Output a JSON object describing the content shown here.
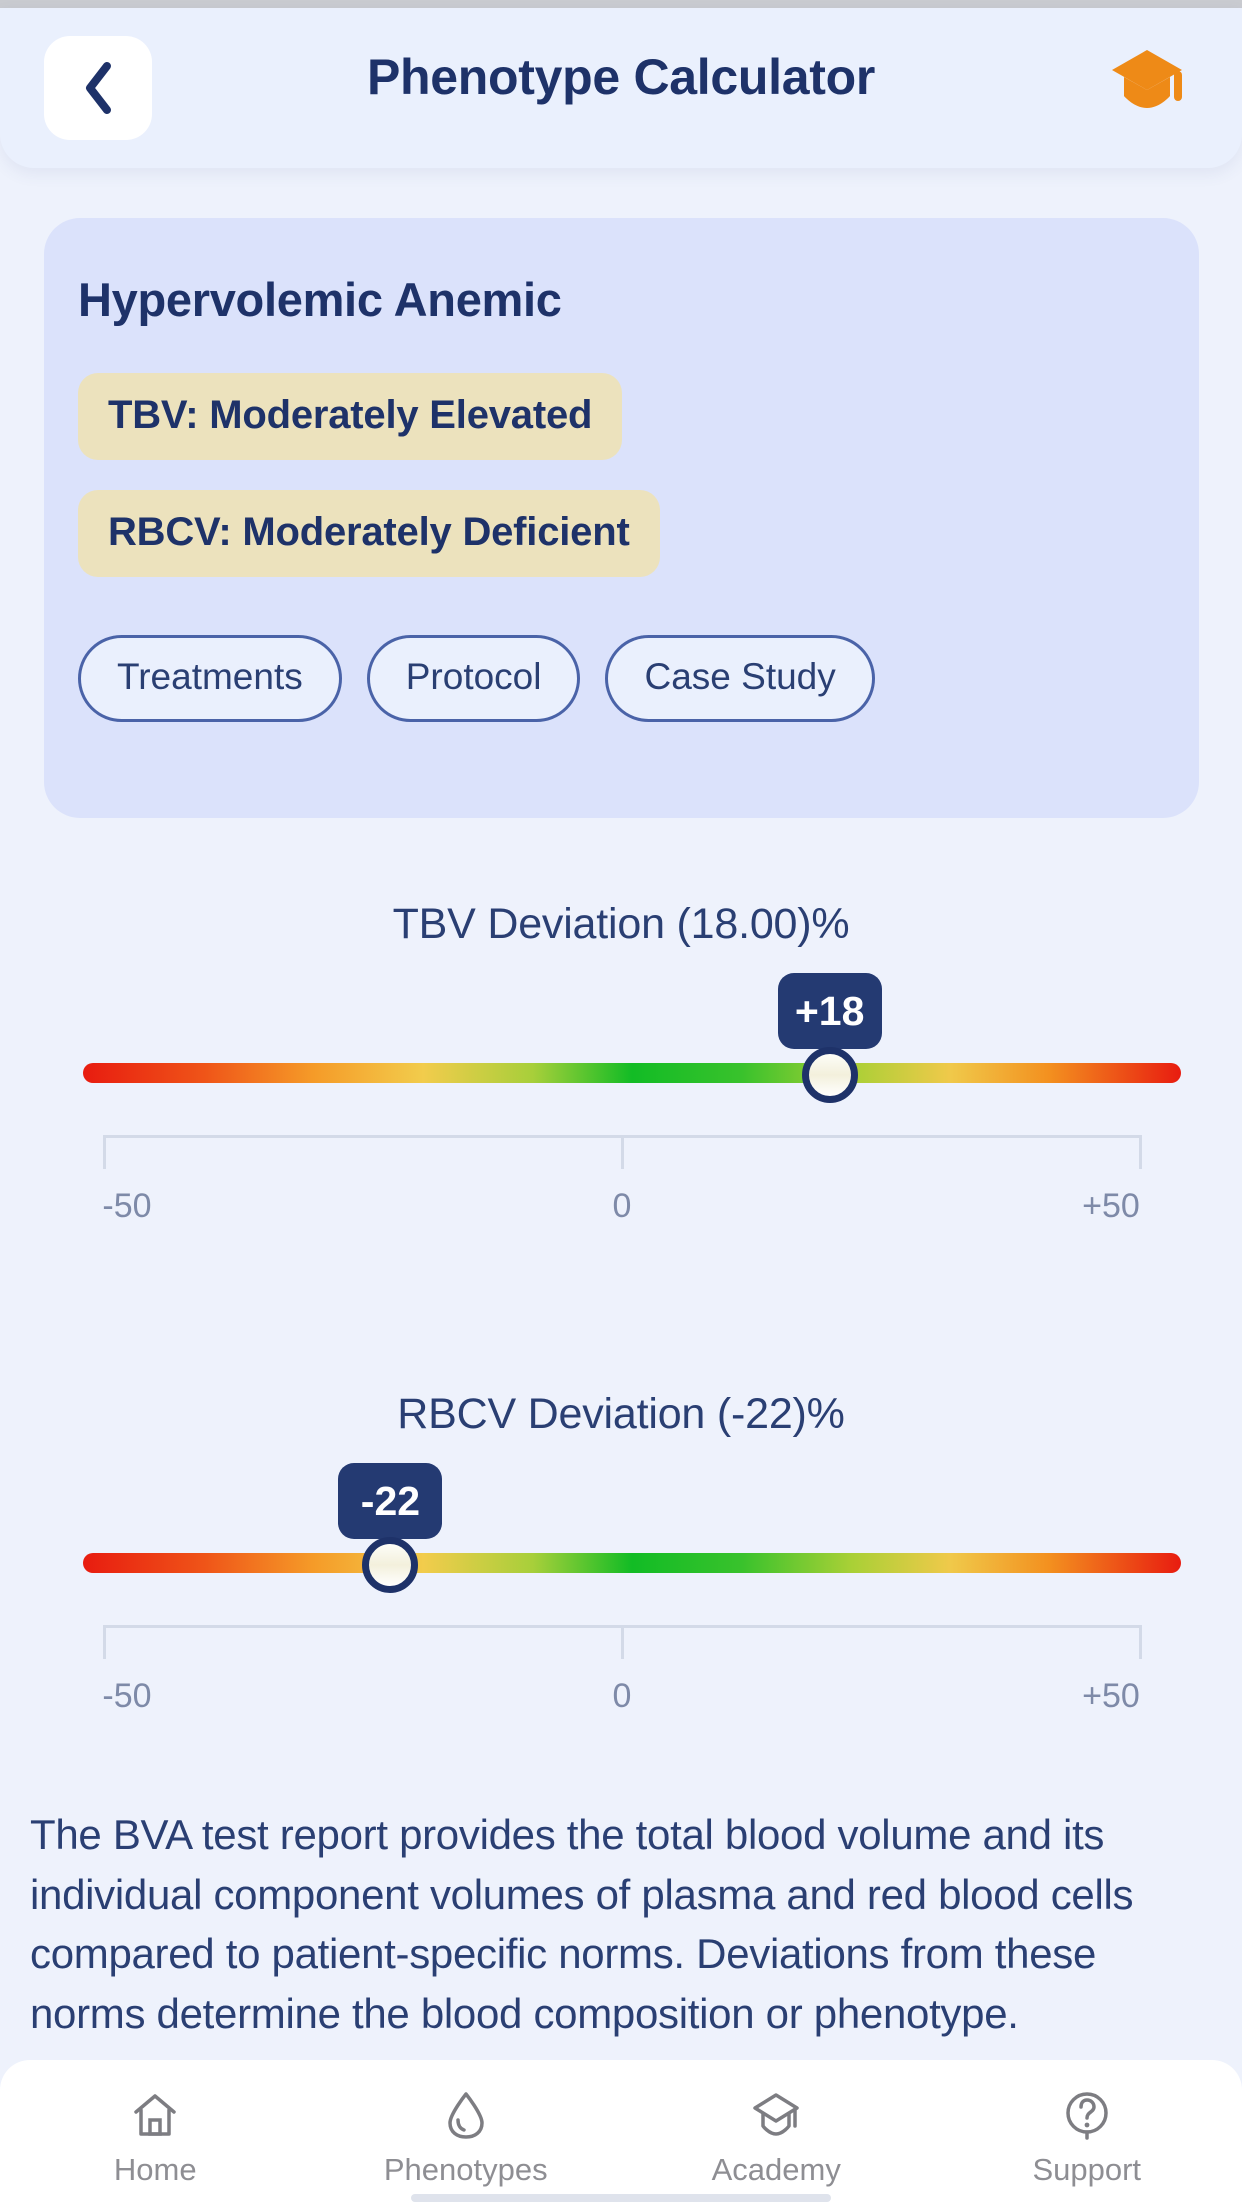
{
  "header": {
    "title": "Phenotype Calculator",
    "back_icon": "chevron-left-icon",
    "logo_icon": "graduation-cap-icon",
    "logo_color": "#EE8A17"
  },
  "phenotype_card": {
    "title": "Hypervolemic Anemic",
    "tags": [
      "TBV: Moderately Elevated",
      "RBCV: Moderately Deficient"
    ],
    "actions": [
      "Treatments",
      "Protocol",
      "Case Study"
    ],
    "bg_color": "#DBE2FB",
    "tag_color": "#ECE2BD",
    "text_color": "#1E3269"
  },
  "sliders": [
    {
      "label": "TBV Deviation (18.00)%",
      "value": 18,
      "bubble": "+18",
      "min": -50,
      "max": 50,
      "scale_labels": [
        "-50",
        "0",
        "+50"
      ]
    },
    {
      "label": "RBCV Deviation (-22)%",
      "value": -22,
      "bubble": "-22",
      "min": -50,
      "max": 50,
      "scale_labels": [
        "-50",
        "0",
        "+50"
      ]
    }
  ],
  "description": "The BVA test report provides the total blood volume and its individual component volumes of plasma and red blood cells compared to patient-specific norms. Deviations from these norms determine the blood composition or phenotype.",
  "bottom_nav": {
    "items": [
      {
        "label": "Home",
        "icon": "home-icon"
      },
      {
        "label": "Phenotypes",
        "icon": "droplet-icon"
      },
      {
        "label": "Academy",
        "icon": "graduation-cap-icon"
      },
      {
        "label": "Support",
        "icon": "question-circle-icon"
      }
    ]
  }
}
